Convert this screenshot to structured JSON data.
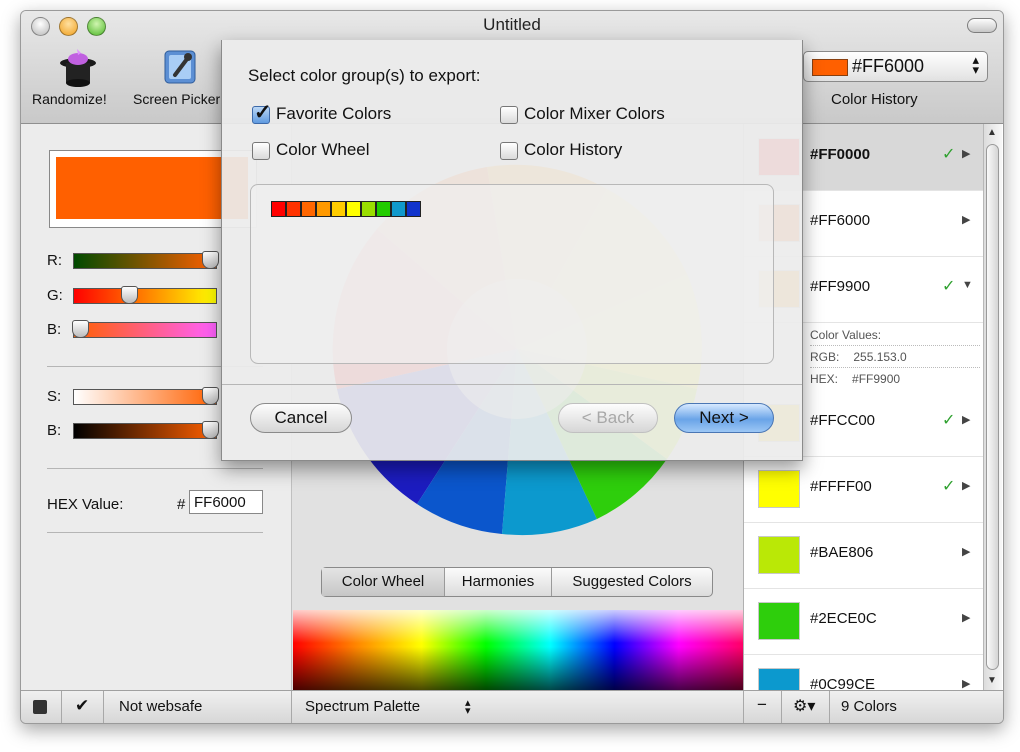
{
  "window": {
    "title": "Untitled"
  },
  "toolbar": {
    "randomize_label": "Randomize!",
    "screen_picker_label": "Screen Picker",
    "current_color": "#FF6000",
    "history_title": "Color History"
  },
  "left_panel": {
    "swatch_color": "#ff6000",
    "sliders": [
      {
        "label": "R:",
        "value_fraction": 1.0
      },
      {
        "label": "G:",
        "value_fraction": 0.38
      },
      {
        "label": "B:",
        "value_fraction": 0.0
      },
      {
        "label": "S:",
        "value_fraction": 1.0
      },
      {
        "label": "B:",
        "value_fraction": 1.0
      }
    ],
    "hex_label": "HEX Value:",
    "hex_hash": "#",
    "hex_value": "FF6000"
  },
  "center": {
    "tabs": [
      "Color Wheel",
      "Harmonies",
      "Suggested Colors"
    ],
    "selected_tab": "Color Wheel"
  },
  "history": {
    "items": [
      {
        "code": "#FF0000",
        "color": "#ff0000",
        "checked": true,
        "expanded": false,
        "selected": true
      },
      {
        "code": "#FF6000",
        "color": "#ff6000",
        "checked": false,
        "expanded": false,
        "selected": false
      },
      {
        "code": "#FF9900",
        "color": "#ff9900",
        "checked": true,
        "expanded": true,
        "selected": false
      },
      {
        "code": "#FFCC00",
        "color": "#ffcc00",
        "checked": true,
        "expanded": false,
        "selected": false
      },
      {
        "code": "#FFFF00",
        "color": "#ffff00",
        "checked": true,
        "expanded": false,
        "selected": false
      },
      {
        "code": "#BAE806",
        "color": "#bae806",
        "checked": false,
        "expanded": false,
        "selected": false
      },
      {
        "code": "#2ECE0C",
        "color": "#2ece0c",
        "checked": false,
        "expanded": false,
        "selected": false
      },
      {
        "code": "#0C99CE",
        "color": "#0c99ce",
        "checked": false,
        "expanded": false,
        "selected": false
      }
    ],
    "details": {
      "heading": "Color Values:",
      "rgb_label": "RGB:",
      "rgb_value": "255.153.0",
      "hex_label": "HEX:",
      "hex_value": "#FF9900"
    },
    "check_glyph": "✓"
  },
  "bottom": {
    "websafe_text": "Not websafe",
    "palette_label": "Spectrum Palette",
    "colors_count": "9 Colors",
    "minus": "−"
  },
  "dialog": {
    "prompt": "Select color group(s) to export:",
    "options": [
      {
        "label": "Favorite Colors",
        "checked": true
      },
      {
        "label": "Color Mixer Colors",
        "checked": false
      },
      {
        "label": "Color Wheel",
        "checked": false
      },
      {
        "label": "Color History",
        "checked": false
      }
    ],
    "preview_colors": [
      "#ff0000",
      "#ff3300",
      "#ff6600",
      "#ff9900",
      "#ffcc00",
      "#ffff00",
      "#99dd00",
      "#22cc00",
      "#1199cc",
      "#1133cc"
    ],
    "cancel_label": "Cancel",
    "back_label": "< Back",
    "next_label": "Next >"
  }
}
